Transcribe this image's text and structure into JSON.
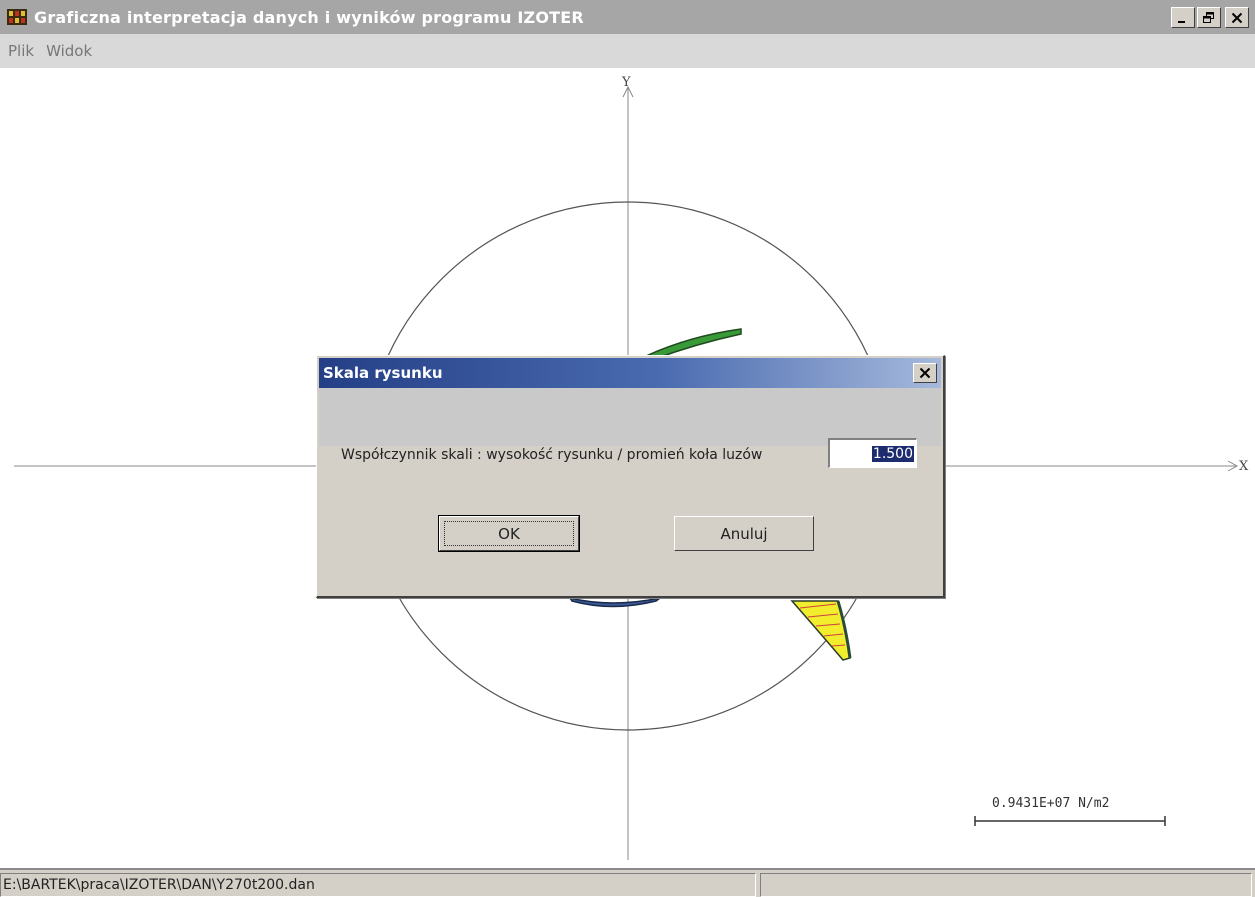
{
  "window": {
    "title": "Graficzna interpretacja danych i wyników programu IZOTER",
    "icon": "app-icon",
    "controls": [
      "minimize-icon",
      "restore-icon",
      "close-icon"
    ]
  },
  "menu": {
    "items": [
      {
        "label": "Plik"
      },
      {
        "label": "Widok"
      }
    ]
  },
  "canvas": {
    "y_axis_label": "Y",
    "x_axis_label": "X",
    "scale_bar_label": "0.9431E+07 N/m2",
    "colors": {
      "axis": "#808080",
      "circle": "#555555",
      "green_region": "#3a9a3a",
      "yellow_region": "#f2ee2e",
      "blue_region": "#3a5a9a",
      "red_lines": "#d04040"
    }
  },
  "dialog": {
    "title": "Skala rysunku",
    "label": "Współczynnik skali : wysokość rysunku / promień koła luzów",
    "input_value": "1.500",
    "ok_label": "OK",
    "cancel_label": "Anuluj"
  },
  "status": {
    "path": "E:\\BARTEK\\praca\\IZOTER\\DAN\\Y270t200.dan",
    "right": ""
  }
}
